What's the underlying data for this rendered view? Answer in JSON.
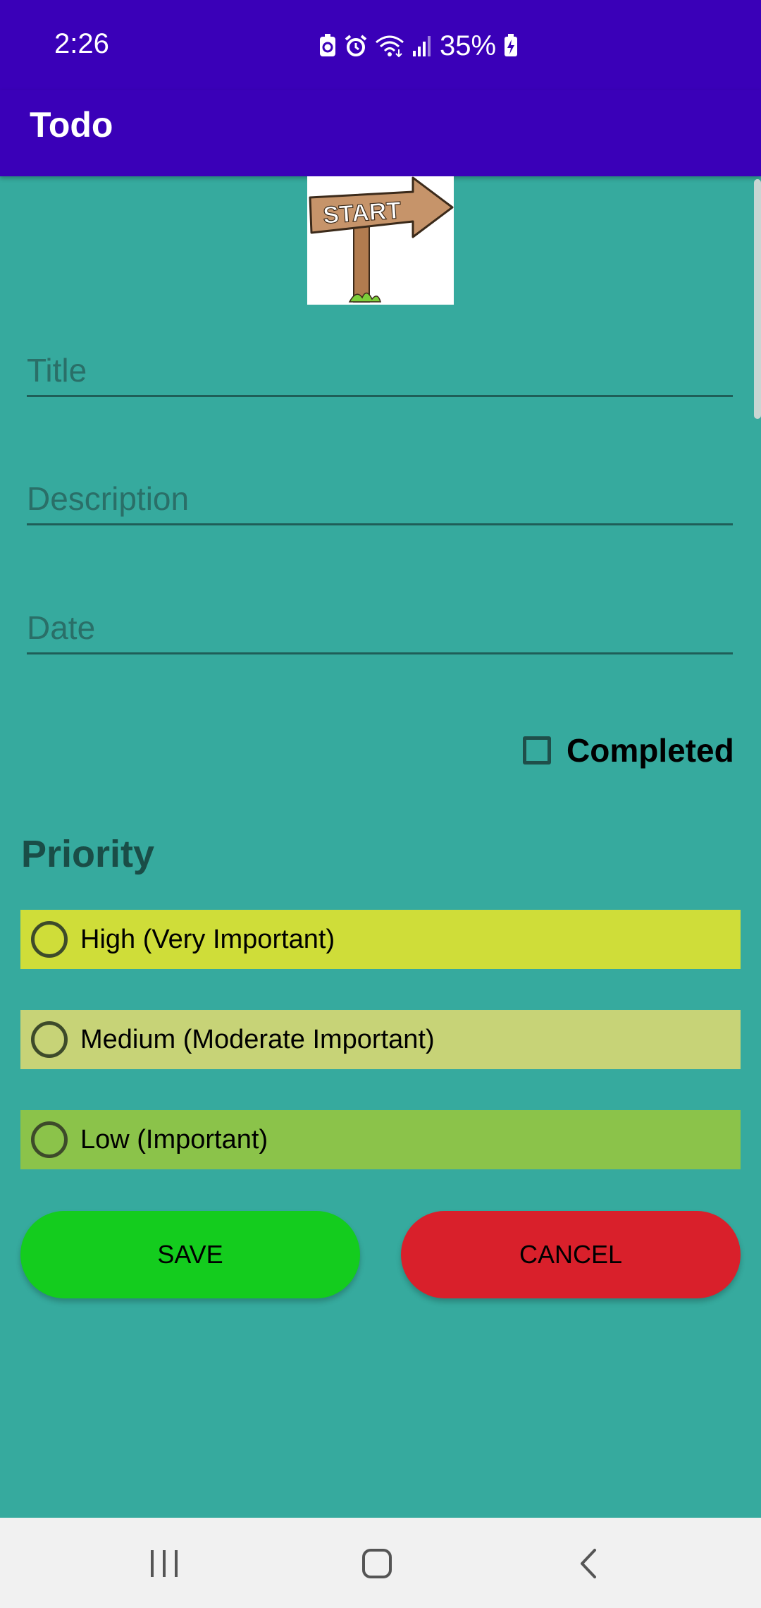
{
  "status_bar": {
    "time": "2:26",
    "battery_percent": "35%",
    "icons": [
      "battery-saver-icon",
      "alarm-icon",
      "wifi-icon",
      "signal-icon",
      "charging-battery-icon"
    ]
  },
  "app_bar": {
    "title": "Todo"
  },
  "logo": {
    "sign_text": "START",
    "icon": "start-signpost-image"
  },
  "form": {
    "title_placeholder": "Title",
    "description_placeholder": "Description",
    "date_placeholder": "Date",
    "completed_label": "Completed",
    "completed_checked": false
  },
  "priority": {
    "heading": "Priority",
    "options": [
      {
        "label": "High (Very Important)",
        "color": "#cfdd39",
        "selected": false
      },
      {
        "label": "Medium (Moderate Important)",
        "color": "#c7d377",
        "selected": false
      },
      {
        "label": "Low (Important)",
        "color": "#8bc34a",
        "selected": false
      }
    ]
  },
  "buttons": {
    "save_label": "SAVE",
    "save_color": "#14cc1e",
    "cancel_label": "CANCEL",
    "cancel_color": "#d9202b"
  },
  "colors": {
    "primary": "#3a00b8",
    "background": "#36aa9e"
  },
  "nav_bar": {
    "icons": [
      "recent-apps-icon",
      "home-icon",
      "back-icon"
    ]
  }
}
